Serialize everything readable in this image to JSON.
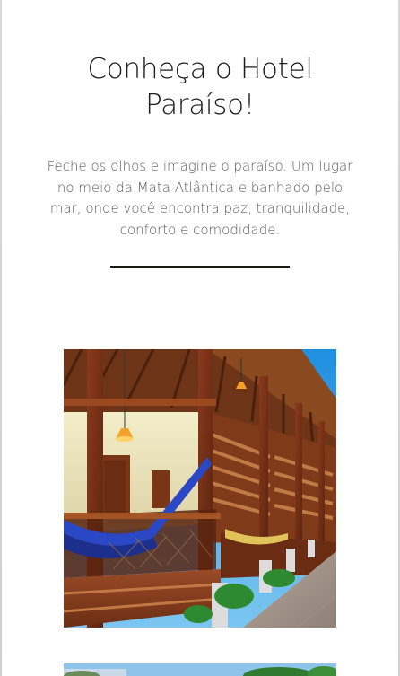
{
  "content": {
    "title": "Conheça o Hotel Paraíso!",
    "intro": "Feche os olhos e imagine o paraíso. Um lugar no meio da Mata Atlântica e banhado pelo mar, onde você encontra paz, tranquilidade, conforto e comodidade."
  },
  "images": [
    {
      "name": "hotel-chalet-photo",
      "alt": ""
    },
    {
      "name": "hotel-garden-photo",
      "alt": ""
    }
  ]
}
